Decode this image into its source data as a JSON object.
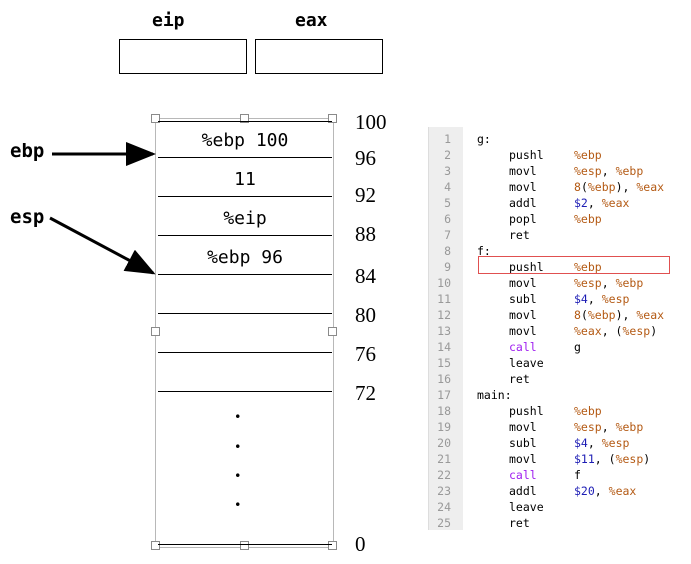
{
  "registers": {
    "eip_label": "eip",
    "eax_label": "eax"
  },
  "pointers": {
    "ebp_label": "ebp",
    "esp_label": "esp"
  },
  "stack_cells": [
    "%ebp 100",
    "11",
    "%eip",
    "%ebp 96",
    "",
    "",
    ""
  ],
  "addresses": [
    "100",
    "96",
    "92",
    "88",
    "84",
    "80",
    "76",
    "72",
    "0"
  ],
  "dots": [
    ".",
    ".",
    ".",
    "."
  ],
  "code_lines": [
    {
      "n": "1",
      "label": "g:"
    },
    {
      "n": "2",
      "op": "pushl",
      "args": [
        [
          "reg",
          "%ebp"
        ]
      ]
    },
    {
      "n": "3",
      "op": "movl",
      "args": [
        [
          "reg",
          "%esp"
        ],
        [
          "plain",
          ", "
        ],
        [
          "reg",
          "%ebp"
        ]
      ]
    },
    {
      "n": "4",
      "op": "movl",
      "args": [
        [
          "reg",
          "8"
        ],
        [
          "plain",
          "("
        ],
        [
          "reg",
          "%ebp"
        ],
        [
          "plain",
          "), "
        ],
        [
          "reg",
          "%eax"
        ]
      ]
    },
    {
      "n": "5",
      "op": "addl",
      "args": [
        [
          "num",
          "$2"
        ],
        [
          "plain",
          ", "
        ],
        [
          "reg",
          "%eax"
        ]
      ]
    },
    {
      "n": "6",
      "op": "popl",
      "args": [
        [
          "reg",
          "%ebp"
        ]
      ]
    },
    {
      "n": "7",
      "op": "ret",
      "args": []
    },
    {
      "n": "8",
      "label": "f:"
    },
    {
      "n": "9",
      "op": "pushl",
      "args": [
        [
          "reg",
          "%ebp"
        ]
      ]
    },
    {
      "n": "10",
      "op": "movl",
      "args": [
        [
          "reg",
          "%esp"
        ],
        [
          "plain",
          ", "
        ],
        [
          "reg",
          "%ebp"
        ]
      ]
    },
    {
      "n": "11",
      "op": "subl",
      "args": [
        [
          "num",
          "$4"
        ],
        [
          "plain",
          ", "
        ],
        [
          "reg",
          "%esp"
        ]
      ]
    },
    {
      "n": "12",
      "op": "movl",
      "args": [
        [
          "reg",
          "8"
        ],
        [
          "plain",
          "("
        ],
        [
          "reg",
          "%ebp"
        ],
        [
          "plain",
          "), "
        ],
        [
          "reg",
          "%eax"
        ]
      ]
    },
    {
      "n": "13",
      "op": "movl",
      "args": [
        [
          "reg",
          "%eax"
        ],
        [
          "plain",
          ", ("
        ],
        [
          "reg",
          "%esp"
        ],
        [
          "plain",
          ")"
        ]
      ]
    },
    {
      "n": "14",
      "op": "call",
      "kw": true,
      "args": [
        [
          "plain",
          "g"
        ]
      ]
    },
    {
      "n": "15",
      "op": "leave",
      "args": []
    },
    {
      "n": "16",
      "op": "ret",
      "args": []
    },
    {
      "n": "17",
      "label": "main:"
    },
    {
      "n": "18",
      "op": "pushl",
      "args": [
        [
          "reg",
          "%ebp"
        ]
      ]
    },
    {
      "n": "19",
      "op": "movl",
      "args": [
        [
          "reg",
          "%esp"
        ],
        [
          "plain",
          ", "
        ],
        [
          "reg",
          "%ebp"
        ]
      ]
    },
    {
      "n": "20",
      "op": "subl",
      "args": [
        [
          "num",
          "$4"
        ],
        [
          "plain",
          ", "
        ],
        [
          "reg",
          "%esp"
        ]
      ]
    },
    {
      "n": "21",
      "op": "movl",
      "args": [
        [
          "num",
          "$11"
        ],
        [
          "plain",
          ", ("
        ],
        [
          "reg",
          "%esp"
        ],
        [
          "plain",
          ")"
        ]
      ]
    },
    {
      "n": "22",
      "op": "call",
      "kw": true,
      "args": [
        [
          "plain",
          "f"
        ]
      ]
    },
    {
      "n": "23",
      "op": "addl",
      "args": [
        [
          "num",
          "$20"
        ],
        [
          "plain",
          ", "
        ],
        [
          "reg",
          "%eax"
        ]
      ]
    },
    {
      "n": "24",
      "op": "leave",
      "args": []
    },
    {
      "n": "25",
      "op": "ret",
      "args": []
    }
  ],
  "highlighted_line": "9",
  "colors": {
    "keyword": "#a020f0",
    "register": "#b45a14",
    "immediate": "#1c1cb4",
    "highlight": "#e05050"
  }
}
